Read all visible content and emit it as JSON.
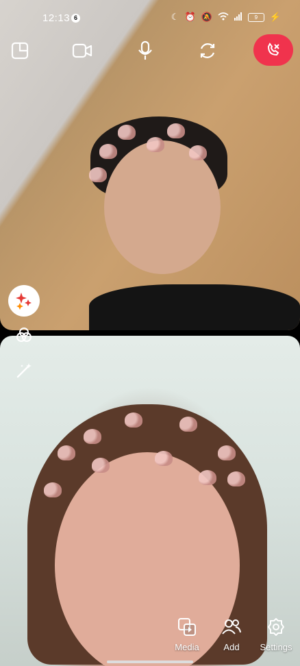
{
  "status_bar": {
    "time": "12:13",
    "badge": "6",
    "battery": "9"
  },
  "controls": {
    "layout_icon": "layout-icon",
    "video_icon": "video-camera-icon",
    "mic_icon": "microphone-icon",
    "switch_icon": "switch-camera-icon",
    "end_call_icon": "end-call-icon"
  },
  "tools": {
    "effects_icon": "sparkle-effects-icon",
    "filters_icon": "filters-icon",
    "magic_icon": "magic-wand-icon"
  },
  "bottom_bar": {
    "media_label": "Media",
    "add_label": "Add",
    "settings_label": "Settings"
  },
  "colors": {
    "end_call": "#f0334d",
    "sparkle_red": "#e53935",
    "sparkle_orange": "#ff8c00"
  }
}
